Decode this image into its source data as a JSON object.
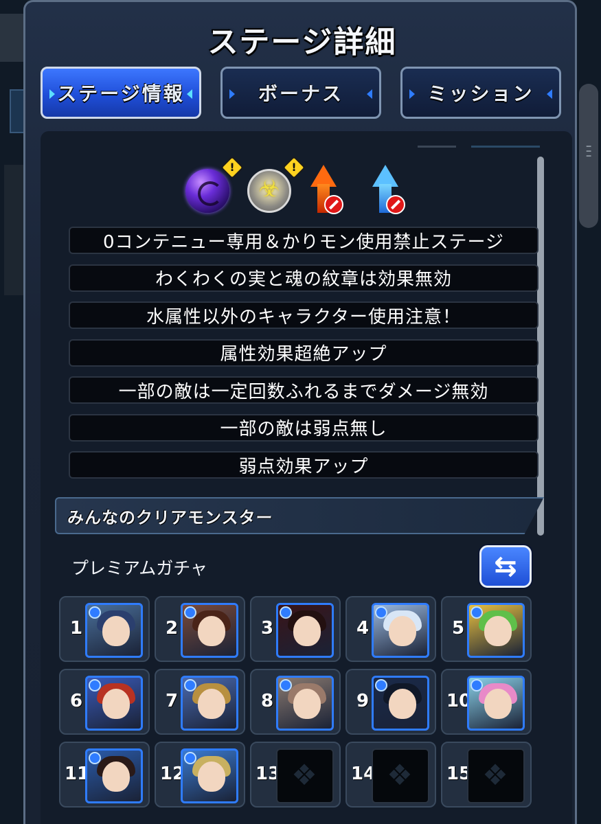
{
  "header": {
    "title": "ステージ詳細"
  },
  "tabs": [
    {
      "label": "ステージ情報",
      "active": true
    },
    {
      "label": "ボーナス",
      "active": false
    },
    {
      "label": "ミッション",
      "active": false
    }
  ],
  "gimmick_icons": [
    "dark-orb-icon",
    "gear-panel-icon",
    "fire-speed-up-disabled-icon",
    "water-speed-up-disabled-icon"
  ],
  "warning_mark": "!",
  "rules": [
    "0コンテニュー専用＆かりモン使用禁止ステージ",
    "わくわくの実と魂の紋章は効果無効",
    "水属性以外のキャラクター使用注意！",
    "属性効果超絶アップ",
    "一部の敵は一定回数ふれるまでダメージ無効",
    "一部の敵は弱点無し",
    "弱点効果アップ"
  ],
  "clear_monsters": {
    "header": "みんなのクリアモンスター",
    "filter_label": "プレミアムガチャ",
    "swap_icon": "swap-arrows-icon",
    "swap_glyph": "⇆",
    "slots": [
      {
        "rank": "1",
        "filled": true
      },
      {
        "rank": "2",
        "filled": true
      },
      {
        "rank": "3",
        "filled": true
      },
      {
        "rank": "4",
        "filled": true
      },
      {
        "rank": "5",
        "filled": true
      },
      {
        "rank": "6",
        "filled": true
      },
      {
        "rank": "7",
        "filled": true
      },
      {
        "rank": "8",
        "filled": true
      },
      {
        "rank": "9",
        "filled": true
      },
      {
        "rank": "10",
        "filled": true
      },
      {
        "rank": "11",
        "filled": true
      },
      {
        "rank": "12",
        "filled": true
      },
      {
        "rank": "13",
        "filled": false
      },
      {
        "rank": "14",
        "filled": false
      },
      {
        "rank": "15",
        "filled": false
      }
    ]
  },
  "colors": {
    "accent_blue": "#2f7cff",
    "tab_active": "#3d77ff",
    "panel_bg": "#1a2436"
  }
}
